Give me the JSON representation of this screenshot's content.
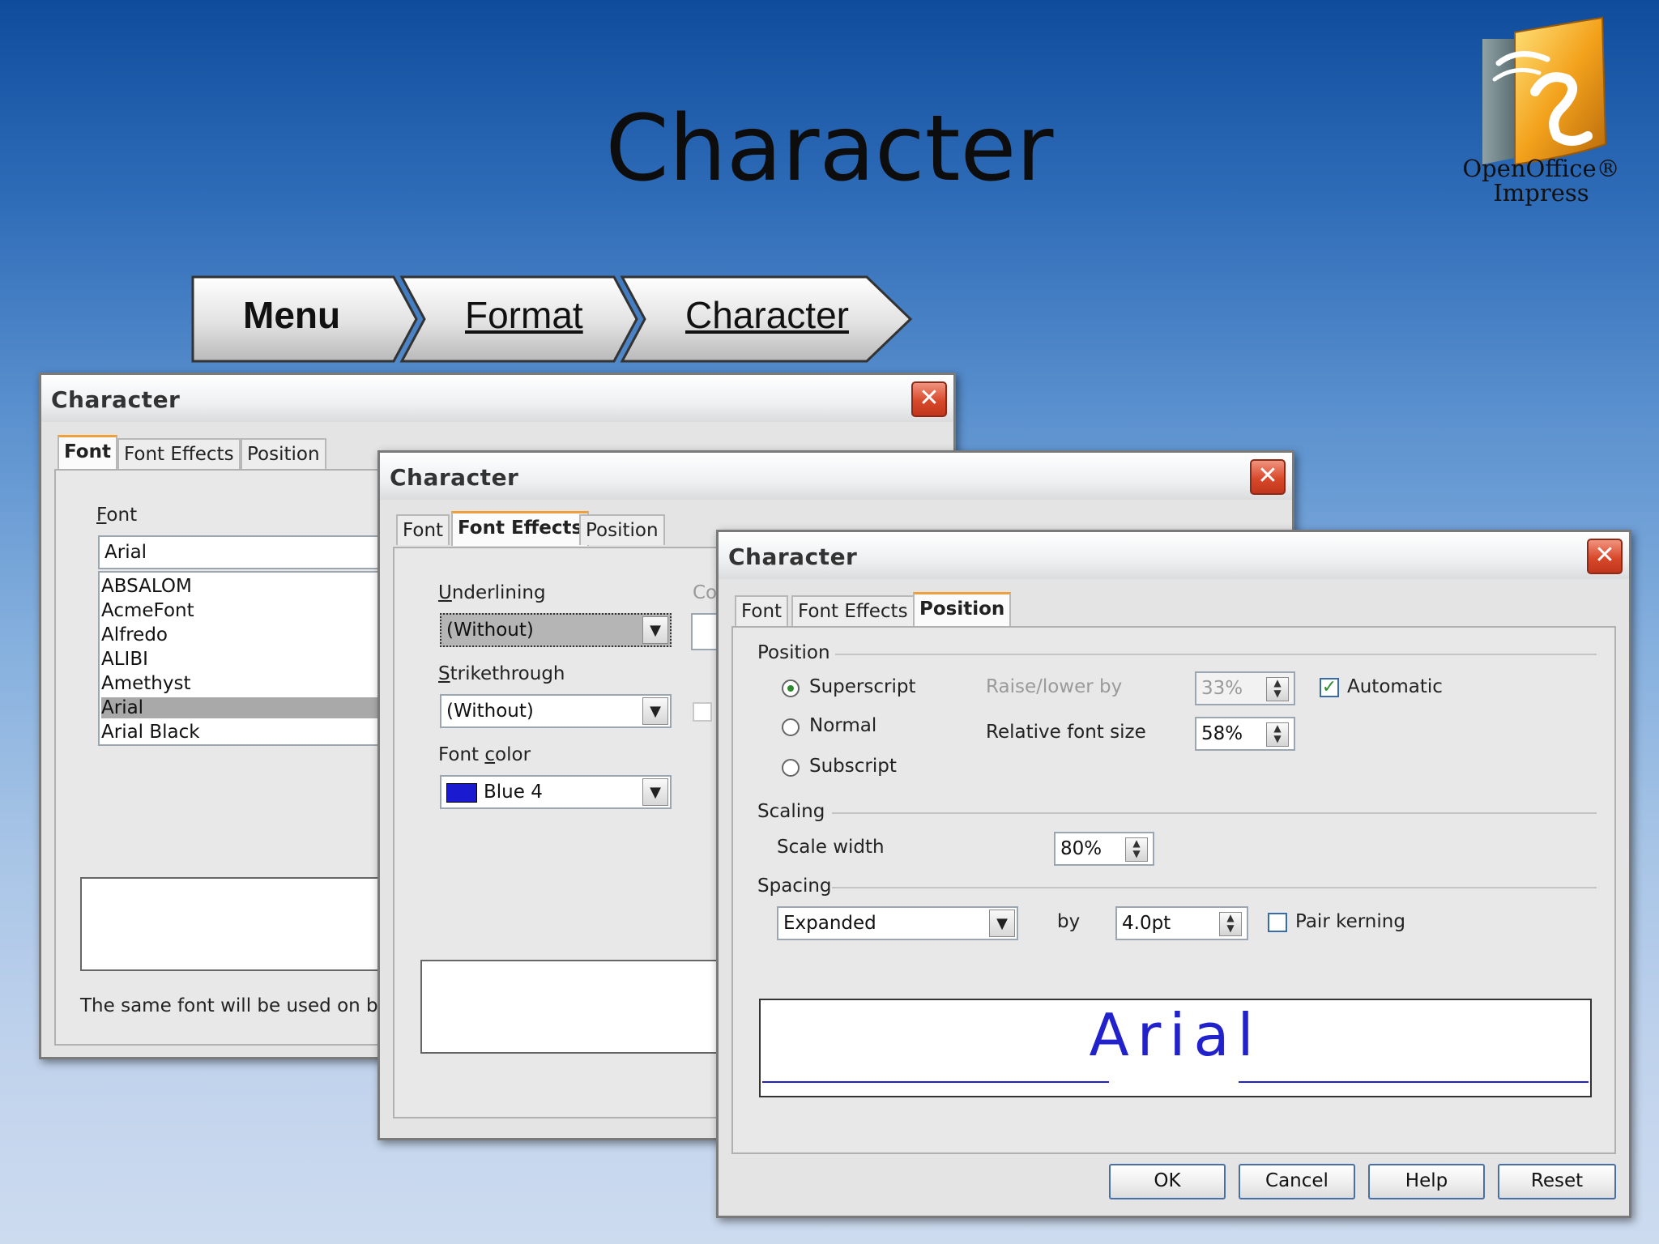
{
  "slide": {
    "title": "Character",
    "logo_line1": "OpenOffice®",
    "logo_line2": "Impress"
  },
  "breadcrumb": {
    "items": [
      "Menu",
      "Format",
      "Character"
    ]
  },
  "dialog1": {
    "title": "Character",
    "tabs": [
      "Font",
      "Font Effects",
      "Position"
    ],
    "active_tab": "Font",
    "font_label": "Font",
    "font_value": "Arial",
    "font_list": [
      "ABSALOM",
      "AcmeFont",
      "Alfredo",
      "ALIBI",
      "Amethyst",
      "Arial",
      "Arial Black"
    ],
    "selected_font": "Arial",
    "footer_note": "The same font will be used on both y"
  },
  "dialog2": {
    "title": "Character",
    "tabs": [
      "Font",
      "Font Effects",
      "Position"
    ],
    "active_tab": "Font Effects",
    "underlining_label": "Underlining",
    "underlining_value": "(Without)",
    "color_label_partial": "Col",
    "strikethrough_label": "Strikethrough",
    "strikethrough_value": "(Without)",
    "font_color_label": "Font color",
    "font_color_value": "Blue 4",
    "font_color_swatch": "#1a1ad0"
  },
  "dialog3": {
    "title": "Character",
    "tabs": [
      "Font",
      "Font Effects",
      "Position"
    ],
    "active_tab": "Position",
    "position_section": "Position",
    "superscript_label": "Superscript",
    "normal_label": "Normal",
    "subscript_label": "Subscript",
    "selected_position": "Superscript",
    "raise_lower_label": "Raise/lower by",
    "raise_lower_value": "33%",
    "automatic_label": "Automatic",
    "automatic_checked": true,
    "relative_size_label": "Relative font size",
    "relative_size_value": "58%",
    "scaling_section": "Scaling",
    "scale_width_label": "Scale width",
    "scale_width_value": "80%",
    "spacing_section": "Spacing",
    "spacing_value": "Expanded",
    "by_label": "by",
    "by_value": "4.0pt",
    "pair_kerning_label": "Pair kerning",
    "pair_kerning_checked": false,
    "preview_text": "Arial",
    "buttons": {
      "ok": "OK",
      "cancel": "Cancel",
      "help": "Help",
      "reset": "Reset"
    }
  },
  "colors": {
    "close_button": "#d8492b",
    "active_tab_accent": "#f0a03a",
    "preview_text": "#2222cc"
  }
}
